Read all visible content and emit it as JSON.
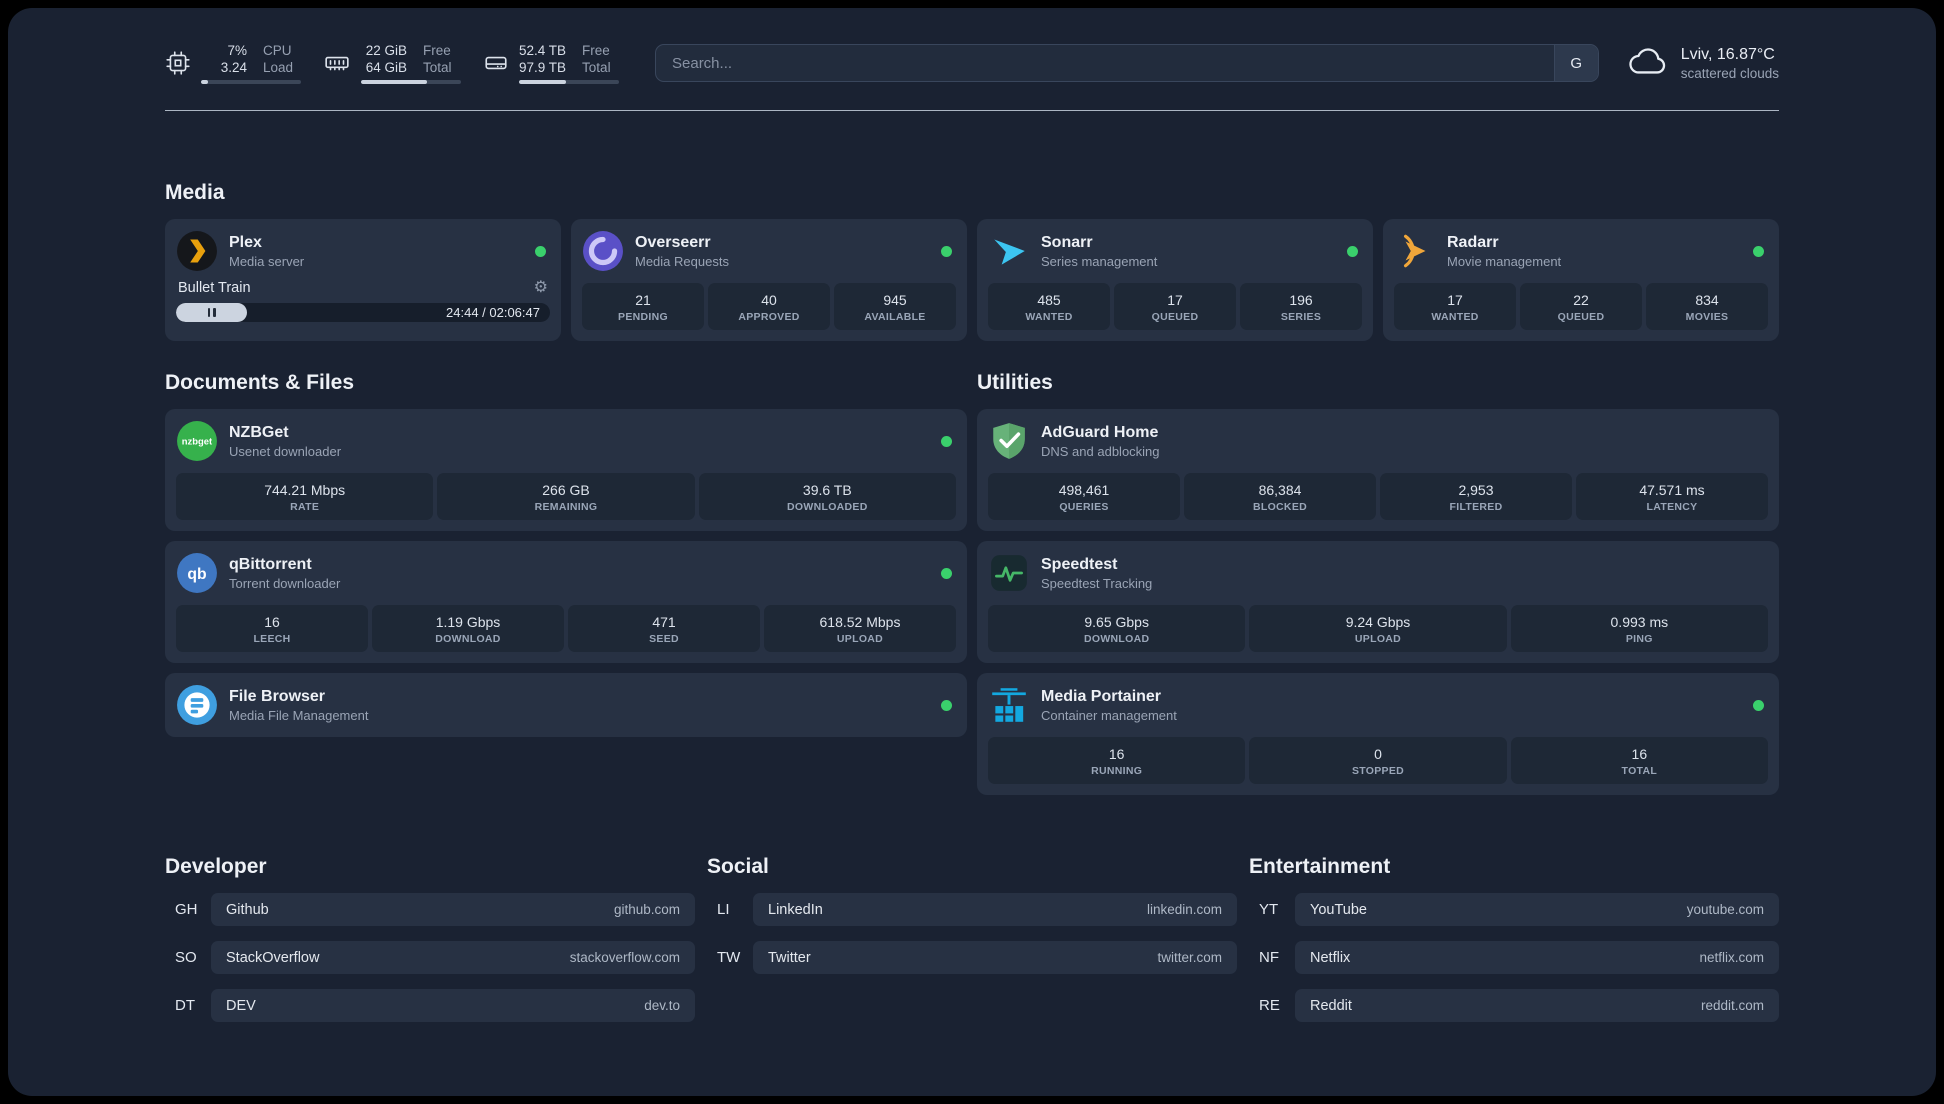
{
  "theme": {
    "background": "#1a2232",
    "card": "#273143",
    "stat_box": "#1e2836",
    "accent_green": "#3ad06c",
    "text_primary": "#eef1f6",
    "text_muted": "#9aa4b5"
  },
  "topbar": {
    "widgets": [
      {
        "icon": "cpu-icon",
        "rows": [
          {
            "value": "7%",
            "label": "CPU"
          },
          {
            "value": "3.24",
            "label": "Load"
          }
        ],
        "progress": 7
      },
      {
        "icon": "memory-icon",
        "rows": [
          {
            "value": "22 GiB",
            "label": "Free"
          },
          {
            "value": "64 GiB",
            "label": "Total"
          }
        ],
        "progress": 66
      },
      {
        "icon": "disk-icon",
        "rows": [
          {
            "value": "52.4 TB",
            "label": "Free"
          },
          {
            "value": "97.9 TB",
            "label": "Total"
          }
        ],
        "progress": 47
      }
    ],
    "search": {
      "placeholder": "Search...",
      "provider_label": "G"
    },
    "weather": {
      "icon": "cloud-icon",
      "location": "Lviv, 16.87°C",
      "condition": "scattered clouds"
    }
  },
  "sections": {
    "media": {
      "title": "Media",
      "cards": [
        {
          "name": "Plex",
          "desc": "Media server",
          "status": "online",
          "icon": "plex-icon",
          "player": {
            "title": "Bullet Train",
            "time": "24:44 / 02:06:47",
            "progress": 19
          }
        },
        {
          "name": "Overseerr",
          "desc": "Media Requests",
          "status": "online",
          "icon": "overseerr-icon",
          "stats": [
            {
              "value": "21",
              "label": "PENDING"
            },
            {
              "value": "40",
              "label": "APPROVED"
            },
            {
              "value": "945",
              "label": "AVAILABLE"
            }
          ]
        },
        {
          "name": "Sonarr",
          "desc": "Series management",
          "status": "online",
          "icon": "sonarr-icon",
          "stats": [
            {
              "value": "485",
              "label": "WANTED"
            },
            {
              "value": "17",
              "label": "QUEUED"
            },
            {
              "value": "196",
              "label": "SERIES"
            }
          ]
        },
        {
          "name": "Radarr",
          "desc": "Movie management",
          "status": "online",
          "icon": "radarr-icon",
          "stats": [
            {
              "value": "17",
              "label": "WANTED"
            },
            {
              "value": "22",
              "label": "QUEUED"
            },
            {
              "value": "834",
              "label": "MOVIES"
            }
          ]
        }
      ]
    },
    "documents": {
      "title": "Documents & Files",
      "cards": [
        {
          "name": "NZBGet",
          "desc": "Usenet downloader",
          "status": "online",
          "icon": "nzbget-icon",
          "stats": [
            {
              "value": "744.21 Mbps",
              "label": "RATE"
            },
            {
              "value": "266 GB",
              "label": "REMAINING"
            },
            {
              "value": "39.6 TB",
              "label": "DOWNLOADED"
            }
          ]
        },
        {
          "name": "qBittorrent",
          "desc": "Torrent downloader",
          "status": "online",
          "icon": "qbittorrent-icon",
          "stats": [
            {
              "value": "16",
              "label": "LEECH"
            },
            {
              "value": "1.19 Gbps",
              "label": "DOWNLOAD"
            },
            {
              "value": "471",
              "label": "SEED"
            },
            {
              "value": "618.52 Mbps",
              "label": "UPLOAD"
            }
          ]
        },
        {
          "name": "File Browser",
          "desc": "Media File Management",
          "status": "online",
          "icon": "filebrowser-icon"
        }
      ]
    },
    "utilities": {
      "title": "Utilities",
      "cards": [
        {
          "name": "AdGuard Home",
          "desc": "DNS and adblocking",
          "icon": "adguard-icon",
          "stats": [
            {
              "value": "498,461",
              "label": "QUERIES"
            },
            {
              "value": "86,384",
              "label": "BLOCKED"
            },
            {
              "value": "2,953",
              "label": "FILTERED"
            },
            {
              "value": "47.571 ms",
              "label": "LATENCY"
            }
          ]
        },
        {
          "name": "Speedtest",
          "desc": "Speedtest Tracking",
          "icon": "speedtest-icon",
          "stats": [
            {
              "value": "9.65 Gbps",
              "label": "DOWNLOAD"
            },
            {
              "value": "9.24 Gbps",
              "label": "UPLOAD"
            },
            {
              "value": "0.993 ms",
              "label": "PING"
            }
          ]
        },
        {
          "name": "Media Portainer",
          "desc": "Container management",
          "status": "online",
          "icon": "portainer-icon",
          "stats": [
            {
              "value": "16",
              "label": "RUNNING"
            },
            {
              "value": "0",
              "label": "STOPPED"
            },
            {
              "value": "16",
              "label": "TOTAL"
            }
          ]
        }
      ]
    }
  },
  "bookmarks": {
    "groups": [
      {
        "title": "Developer",
        "items": [
          {
            "abbr": "GH",
            "name": "Github",
            "url": "github.com"
          },
          {
            "abbr": "SO",
            "name": "StackOverflow",
            "url": "stackoverflow.com"
          },
          {
            "abbr": "DT",
            "name": "DEV",
            "url": "dev.to"
          }
        ]
      },
      {
        "title": "Social",
        "items": [
          {
            "abbr": "LI",
            "name": "LinkedIn",
            "url": "linkedin.com"
          },
          {
            "abbr": "TW",
            "name": "Twitter",
            "url": "twitter.com"
          }
        ]
      },
      {
        "title": "Entertainment",
        "items": [
          {
            "abbr": "YT",
            "name": "YouTube",
            "url": "youtube.com"
          },
          {
            "abbr": "NF",
            "name": "Netflix",
            "url": "netflix.com"
          },
          {
            "abbr": "RE",
            "name": "Reddit",
            "url": "reddit.com"
          }
        ]
      }
    ]
  }
}
